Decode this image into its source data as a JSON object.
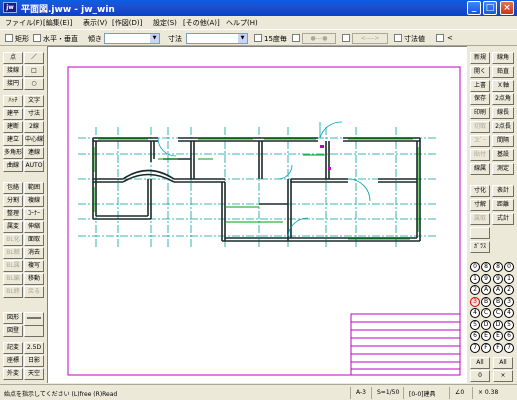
{
  "window": {
    "title": "平面図.jww - jw_win",
    "app_icon": "jw"
  },
  "menu": [
    "ファイル(F)",
    "[編集(E)]",
    "表示(V)",
    "[作図(D)]",
    "設定(S)",
    "[その他(A)]",
    "ヘルプ(H)"
  ],
  "toolbar": {
    "rect_label": "矩形",
    "horiz_vert_label": "水平・垂直",
    "slope_label": "傾き",
    "dim_label": "寸法",
    "deg15_label": "15度毎",
    "btn_circle": "●---●",
    "btn_arrow": "<---->",
    "dim_value_label": "寸法値",
    "lt_label": "<"
  },
  "left_panel": [
    [
      "点",
      "／"
    ],
    [
      "接線",
      "□"
    ],
    [
      "接円",
      "○"
    ],
    [
      "ﾊｯﾁ",
      "文字"
    ],
    [
      "建平",
      "寸法"
    ],
    [
      "建断",
      "2線"
    ],
    [
      "建立",
      "中心線"
    ],
    [
      "多角形",
      "連線"
    ],
    [
      "曲線",
      "AUTO"
    ],
    [
      "包絡",
      "範囲"
    ],
    [
      "分割",
      "複線"
    ],
    [
      "整理",
      "ｺｰﾅｰ"
    ],
    [
      "属変",
      "伸縮"
    ],
    [
      "BL化",
      "面取"
    ],
    [
      "BL解",
      "消去"
    ],
    [
      "BL属",
      "複写"
    ],
    [
      "BL編",
      "移動"
    ],
    [
      "BL終",
      "戻る"
    ],
    [
      "図形",
      ""
    ],
    [
      "図登",
      ""
    ],
    [
      "記変",
      "2.5D"
    ],
    [
      "座標",
      "日影"
    ],
    [
      "外変",
      "天空"
    ]
  ],
  "right_panel_a": [
    [
      "新規",
      "開く",
      "上書",
      "保存",
      "印刷",
      "切取",
      "ｺﾋﾟｰ",
      "貼付",
      "線属",
      "寸化",
      "寸解",
      "属取",
      "",
      "ｶﾞﾗｽ"
    ],
    [
      "線角",
      "鉛直",
      "Ｘ軸",
      "2点角",
      "線長",
      "2点長",
      "間隔",
      "基設",
      "測定",
      "表計",
      "距離",
      "式計"
    ]
  ],
  "right_header": "属取",
  "layers": {
    "groups": [
      [
        "0",
        "1",
        "2",
        "3",
        "4",
        "5",
        "6",
        "7"
      ],
      [
        "8",
        "9",
        "A",
        "B",
        "C",
        "D",
        "E",
        "F"
      ]
    ],
    "all_label": "All",
    "x_label": "×"
  },
  "status": {
    "message": "始点を指示してください (L)free (R)Read",
    "paper": "A-3",
    "scale": "S=1/50",
    "layer": "[0-0]建具",
    "angle": "∠0",
    "zoom": "× 0.38"
  }
}
